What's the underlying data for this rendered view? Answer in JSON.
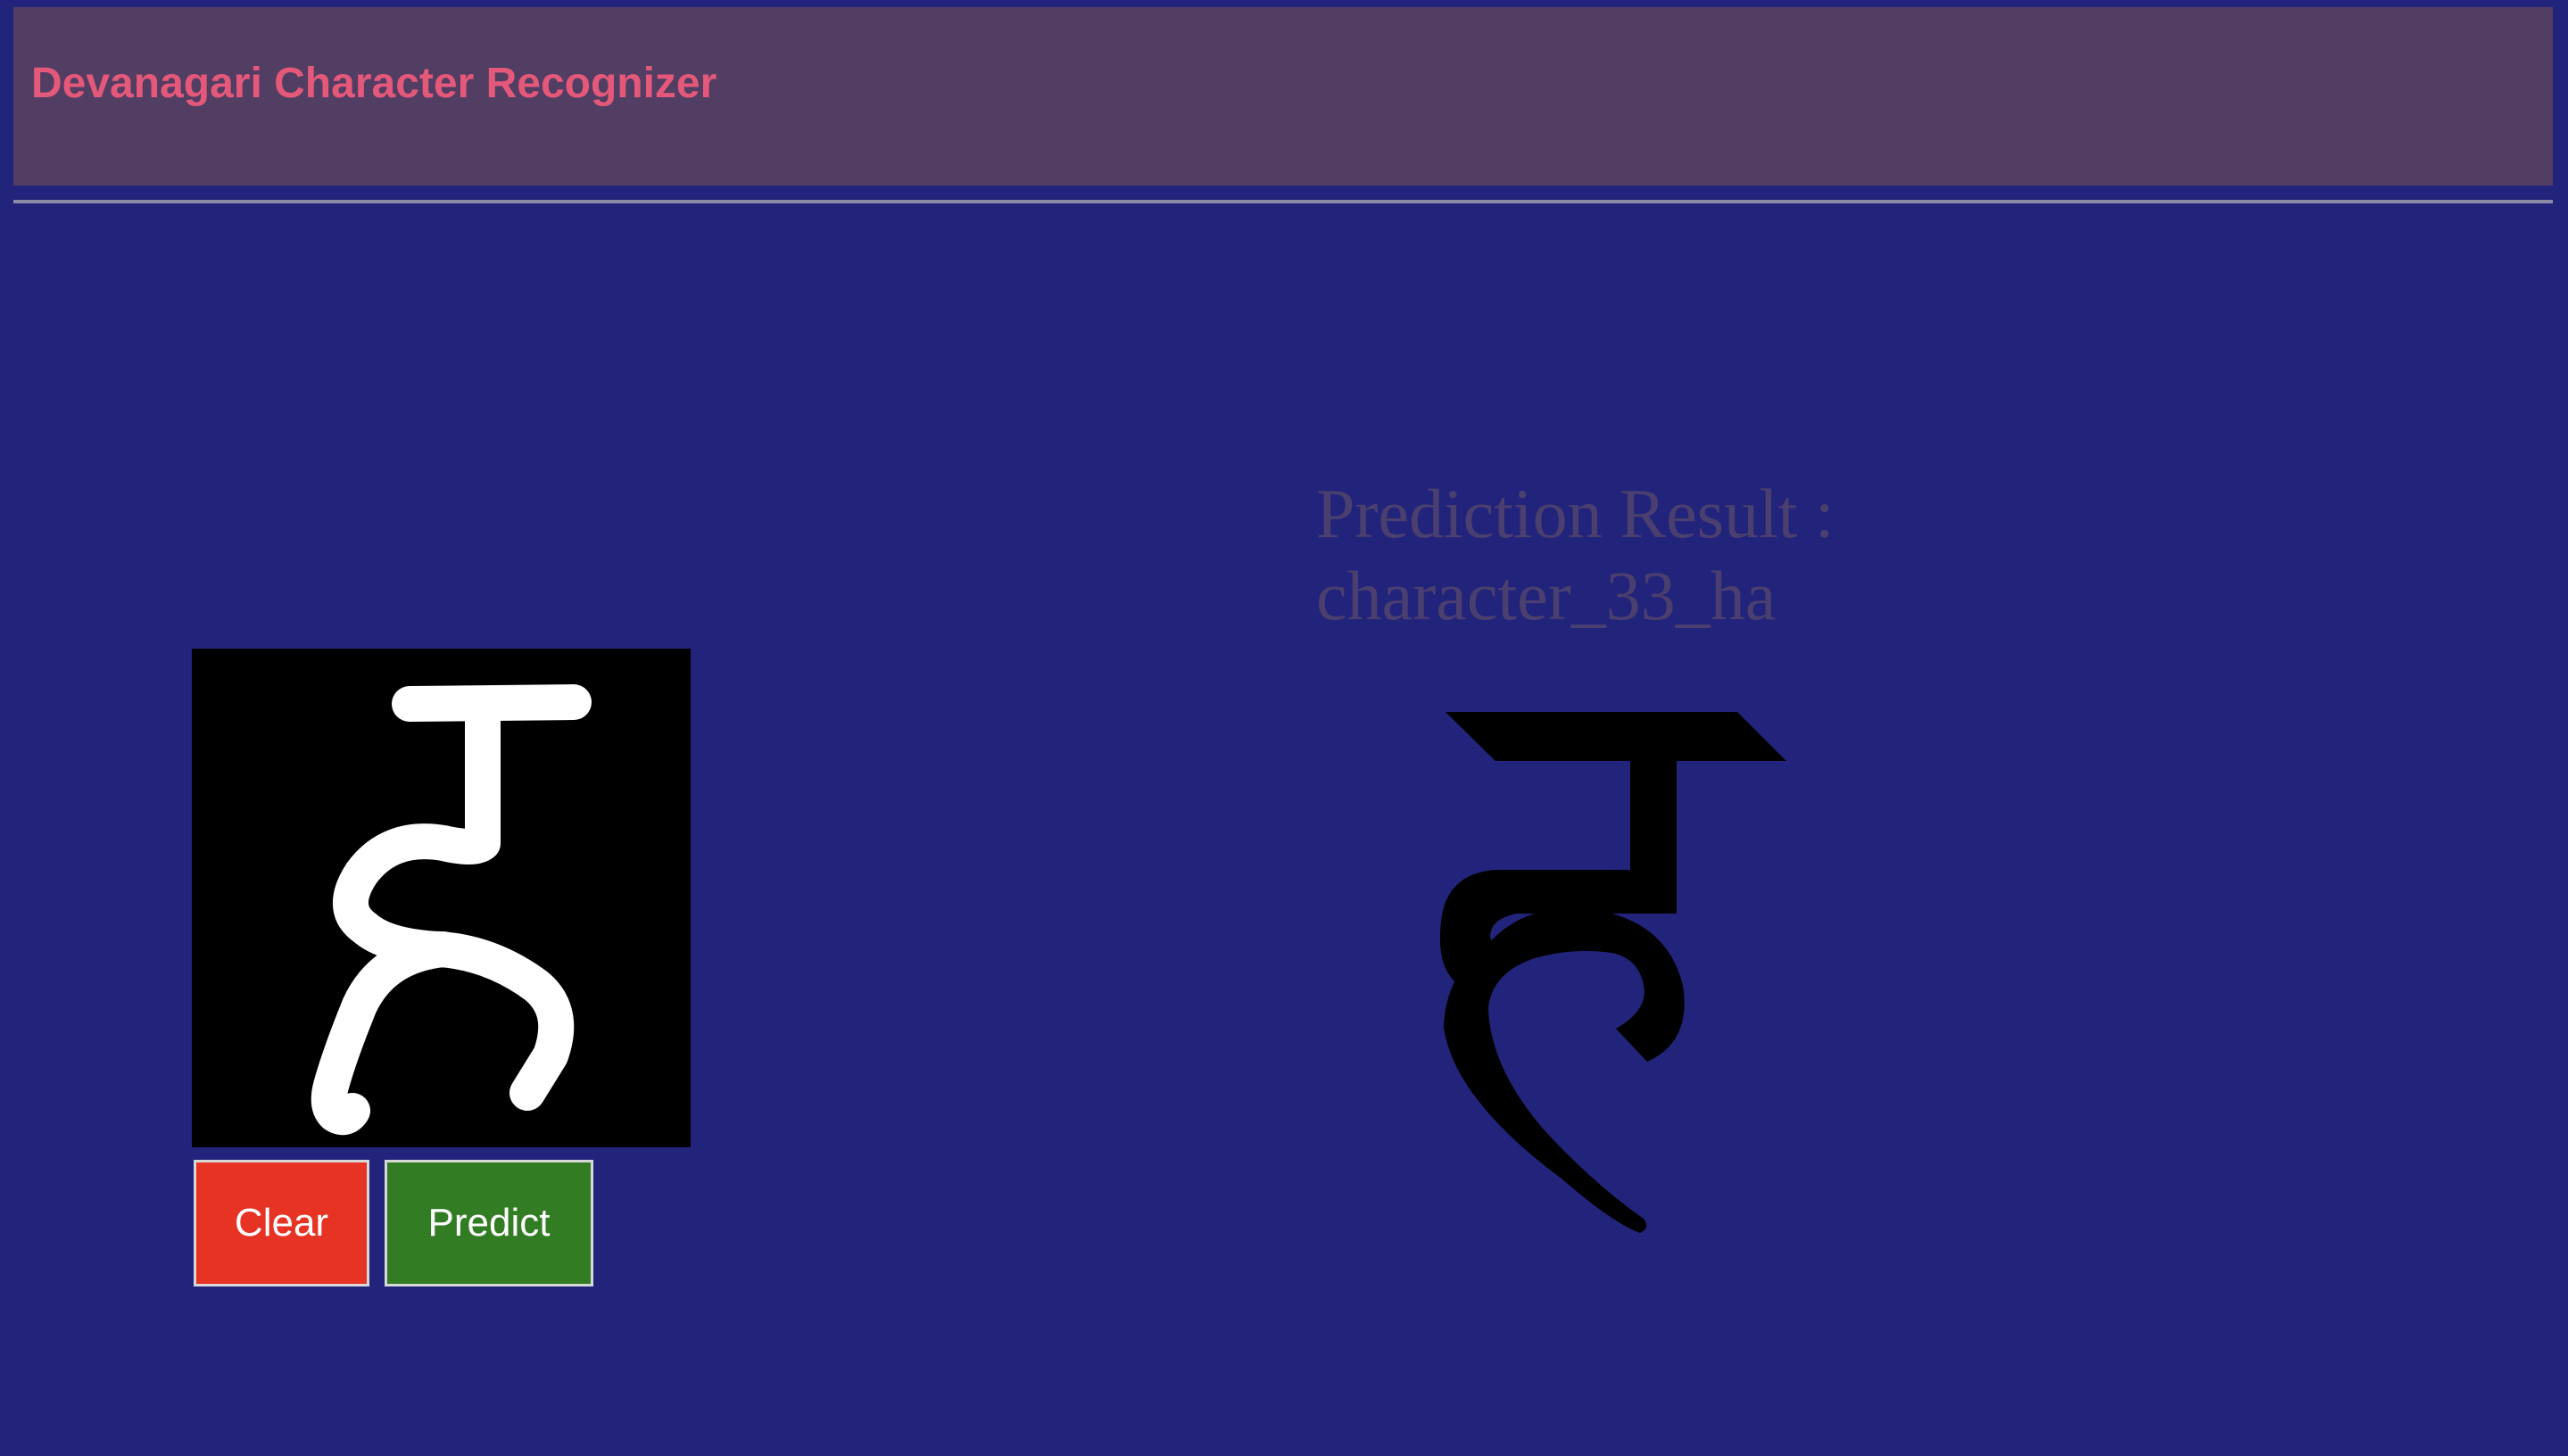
{
  "app": {
    "title": "Devanagari Character Recognizer"
  },
  "buttons": {
    "clear_label": "Clear",
    "predict_label": "Predict"
  },
  "prediction": {
    "label": "Prediction Result :",
    "value": "character_33_ha"
  },
  "icons": {
    "drawn_character": "handwritten-ha-stroke",
    "result_character": "devanagari-ha-glyph"
  },
  "colors": {
    "page_background": "#22247b",
    "header_background": "#523d63",
    "title_text": "#e4587a",
    "prediction_text": "#4b3f6f",
    "canvas_background": "#000000",
    "stroke": "#ffffff",
    "clear_button": "#e63323",
    "predict_button": "#327d23",
    "result_glyph": "#000000"
  }
}
